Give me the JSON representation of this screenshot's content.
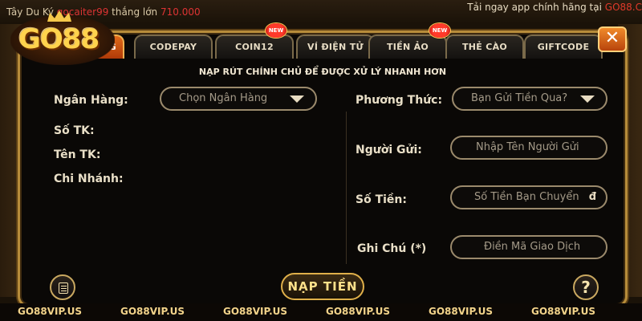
{
  "background": {
    "ticker_name": "Tây Du Ký",
    "ticker_user": "gocaiter99",
    "ticker_action": "thắng lớn",
    "ticker_amount": "710.000",
    "app_notice_prefix": "Tải ngay app chính hãng tại",
    "app_notice_site": "GO88.C"
  },
  "brand": {
    "logo_text": "GO88"
  },
  "tabs": [
    {
      "label": "NG",
      "active": true,
      "badge": ""
    },
    {
      "label": "CODEPAY",
      "active": false,
      "badge": ""
    },
    {
      "label": "COIN12",
      "active": false,
      "badge": "NEW"
    },
    {
      "label": "VÍ ĐIỆN TỬ",
      "active": false,
      "badge": ""
    },
    {
      "label": "TIỀN ẢO",
      "active": false,
      "badge": "NEW"
    },
    {
      "label": "THẺ CÀO",
      "active": false,
      "badge": ""
    },
    {
      "label": "GIFTCODE",
      "active": false,
      "badge": ""
    }
  ],
  "close_label": "✕",
  "notice": "NẠP RÚT CHÍNH CHỦ ĐỂ ĐƯỢC XỬ LÝ NHANH HƠN",
  "left": {
    "bank_label": "Ngân Hàng:",
    "bank_select_value": "Chọn Ngân Hàng",
    "account_no_label": "Số TK:",
    "account_name_label": "Tên TK:",
    "branch_label": "Chi Nhánh:"
  },
  "right": {
    "method_label": "Phương Thức:",
    "method_select_value": "Bạn Gửi Tiền Qua?",
    "sender_label": "Người Gửi:",
    "sender_placeholder": "Nhập Tên Người Gửi",
    "amount_label": "Số Tiền:",
    "amount_placeholder": "Số Tiền Bạn Chuyển",
    "amount_suffix": "đ",
    "note_label": "Ghi Chú (*)",
    "note_placeholder": "Điền Mã Giao Dịch"
  },
  "submit_label": "NẠP TIỀN",
  "help_label": "?",
  "footer": [
    "GO88VIP.US",
    "GO88VIP.US",
    "GO88VIP.US",
    "GO88VIP.US",
    "GO88VIP.US",
    "GO88VIP.US"
  ],
  "colors": {
    "accent_gold": "#e0b04a",
    "active_tab": "#e06a1a",
    "badge_red": "#ff3a2a"
  }
}
